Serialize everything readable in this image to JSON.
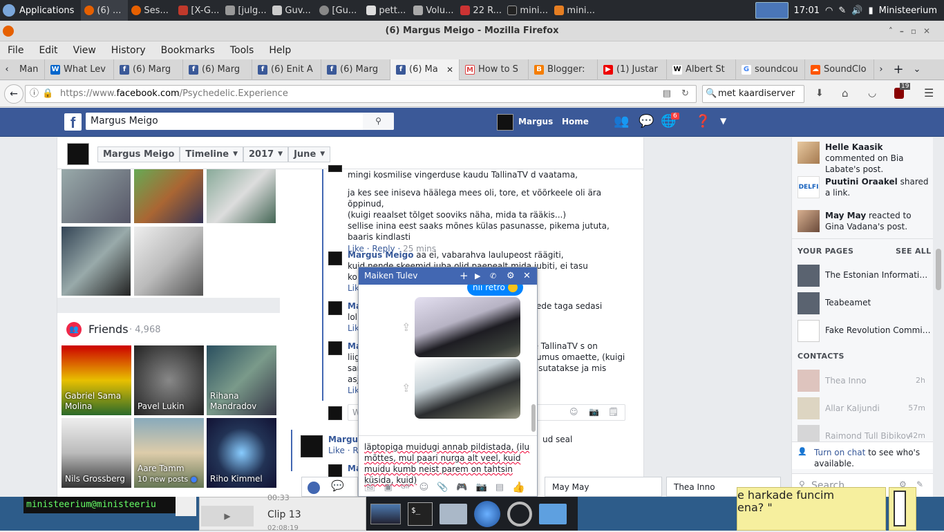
{
  "panel": {
    "apps_label": "Applications",
    "clock": "17:01",
    "user": "Ministeerium",
    "tasks": [
      "(6) ...",
      "Ses...",
      "[X-G...",
      "[julg...",
      "Guv...",
      "[Gu...",
      "pett...",
      "Volu...",
      "22 R...",
      "mini...",
      "mini..."
    ]
  },
  "window": {
    "title": "(6) Margus Meigo - Mozilla Firefox"
  },
  "menu": [
    "File",
    "Edit",
    "View",
    "History",
    "Bookmarks",
    "Tools",
    "Help"
  ],
  "tabs": [
    "Man",
    "What Lev",
    "(6) Marg",
    "(6) Marg",
    "(6) Enit A",
    "(6) Marg",
    "(6) Ma",
    "How to S",
    "Blogger:",
    "(1) Justar",
    "Albert St",
    "soundcou",
    "SoundClo"
  ],
  "url": {
    "prefix": "https://www.",
    "domain": "facebook.com",
    "path": "/Psychedelic.Experience"
  },
  "search": {
    "value": "met kaardiserver"
  },
  "toolbar": {
    "badge": "19"
  },
  "fb": {
    "search_value": "Margus Meigo",
    "profile_name": "Margus",
    "home": "Home",
    "notif_count": "6"
  },
  "timeline_nav": {
    "name": "Margus Meigo",
    "timeline": "Timeline",
    "year": "2017",
    "month": "June"
  },
  "friends": {
    "title": "Friends",
    "count": "· 4,968",
    "list": [
      {
        "name": "Gabriel Sama Molina",
        "sub": ""
      },
      {
        "name": "Pavel Lukin",
        "sub": ""
      },
      {
        "name": "Rihana Mandradov",
        "sub": ""
      },
      {
        "name": "Nils Grossberg",
        "sub": ""
      },
      {
        "name": "Aare Tamm",
        "sub": "10 new posts"
      },
      {
        "name": "Riho Kimmel",
        "sub": ""
      }
    ]
  },
  "comments": {
    "c1_line1": "mingi kosmilise vingerduse kaudu TallinaTV d vaatama,",
    "c1_line2": "ja kes see iniseva häälega mees oli, tore, et võõrkeele oli ära õppinud,",
    "c1_line3": "(kuigi reaalset tõlget sooviks näha, mida ta rääkis...)",
    "c1_line4": "sellise inina eest saaks mõnes külas pasunasse, pikema jututa,",
    "c1_line5": "baaris kindlasti",
    "like": "Like",
    "reply": "Reply",
    "c1_time": "25 mins",
    "c2_author": "Margus Meigo",
    "c2_text": "aa ei, vabarahva laulupeost räägiti,",
    "c2_line2": "kuid nende skeemid juba olid paepealt mida jubiti, ei tasu",
    "c2_line3": "ko",
    "c3_author": "Ma",
    "c3_right": "ulede taga sedasi",
    "c3_line2": "lol",
    "c4_author": "Ma",
    "c4_right1": "ce TallinaTV s on",
    "c4_l2": "liig",
    "c4_right2": "tsumus omaette, (kuigi",
    "c4_l3": "sar",
    "c4_right3": "kasutatakse ja mis",
    "c4_l4": "asj",
    "write_placeholder": "W",
    "bottom_author": "Margus",
    "bottom_right": "ud seal",
    "bottom_like": "Like",
    "bottom_reply": "Re",
    "bottom2": "Ma"
  },
  "ticker": [
    {
      "name": "Helle Kaasik",
      "rest": " commented on Bia Labate's post."
    },
    {
      "name": "Puutini Oraakel",
      "rest": " shared a link."
    },
    {
      "name": "May May",
      "rest": " reacted to Gina Vadana's post."
    }
  ],
  "your_pages": {
    "title": "YOUR PAGES",
    "see_all": "SEE ALL",
    "items": [
      "The Estonian Information ...",
      "Teabeamet",
      "Fake Revolution Commie..."
    ]
  },
  "contacts": {
    "title": "CONTACTS",
    "items": [
      {
        "name": "Thea Inno",
        "time": "2h"
      },
      {
        "name": "Allar Kaljundi",
        "time": "57m"
      },
      {
        "name": "Raimond Tull Bibikov",
        "time": "42m"
      }
    ],
    "chat_prompt_link": "Turn on chat",
    "chat_prompt_rest": " to see who's available.",
    "search_placeholder": "Search"
  },
  "chat": {
    "title": "Maiken Tulev",
    "bubble": "nii retro",
    "message": "läptopiga muidugi annab pildistada,  (ilu mõttes, mul paari nurga alt veel, kuid muidu kumb neist parem on tahtsin küsida, kuid)"
  },
  "chat_tabs": [
    "May May",
    "Thea Inno"
  ],
  "dock": {
    "terminal": "ministeerium@ministeeriu",
    "clip_time1": "00:33",
    "clip_title": "Clip 13",
    "clip_time2": "02:08:19",
    "yellow_text1": "e harkade funcim",
    "yellow_text2": "ena?  \""
  },
  "colors": {
    "fb_blue": "#3b5998",
    "link": "#365899",
    "panel": "#26292e"
  }
}
